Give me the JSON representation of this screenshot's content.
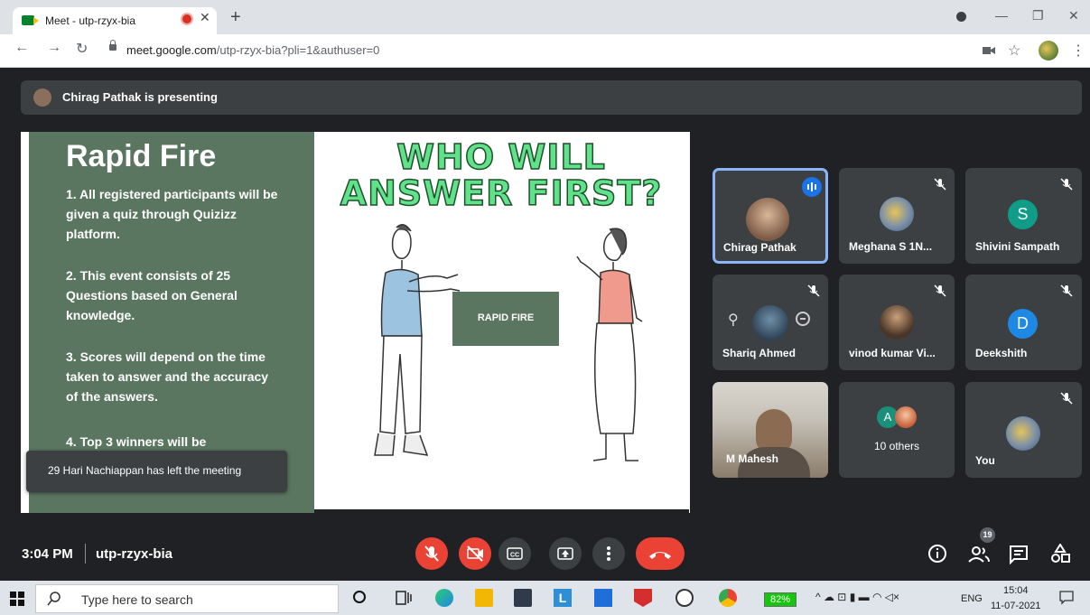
{
  "browser": {
    "tab_title": "Meet - utp-rzyx-bia",
    "url_host": "meet.google.com",
    "url_path": "/utp-rzyx-bia?pli=1&authuser=0"
  },
  "meet": {
    "presenting_text": "Chirag Pathak is presenting",
    "toast": "29 Hari Nachiappan has left the meeting",
    "time": "3:04 PM",
    "meeting_code": "utp-rzyx-bia",
    "people_count": "19"
  },
  "slide": {
    "title": "Rapid Fire",
    "rules": [
      "1. All registered participants will be given a quiz through Quizizz platform.",
      "2. This event consists of 25 Questions based on General knowledge.",
      "3. Scores will depend on the time taken to answer and the accuracy of the answers.",
      "4. Top 3 winners will be"
    ],
    "headline": "WHO WILL ANSWER FIRST?",
    "box_label": "RAPID FIRE"
  },
  "participants": {
    "chirag": "Chirag Pathak",
    "meghana": "Meghana S 1N...",
    "shivini": "Shivini Sampath",
    "shivini_initial": "S",
    "shariq": "Shariq Ahmed",
    "vinod": "vinod kumar Vi...",
    "deekshith": "Deekshith",
    "deekshith_initial": "D",
    "mahesh": "M Mahesh",
    "others": "10 others",
    "others_initial": "A",
    "you": "You"
  },
  "taskbar": {
    "search_placeholder": "Type here to search",
    "battery": "82%",
    "lang": "ENG",
    "clock_time": "15:04",
    "clock_date": "11-07-2021"
  },
  "colors": {
    "meet_bg": "#202124",
    "tile_bg": "#3c4043",
    "end_call": "#ea4335",
    "active_speaker_border": "#8ab4f8",
    "slide_green": "#5a7560"
  }
}
